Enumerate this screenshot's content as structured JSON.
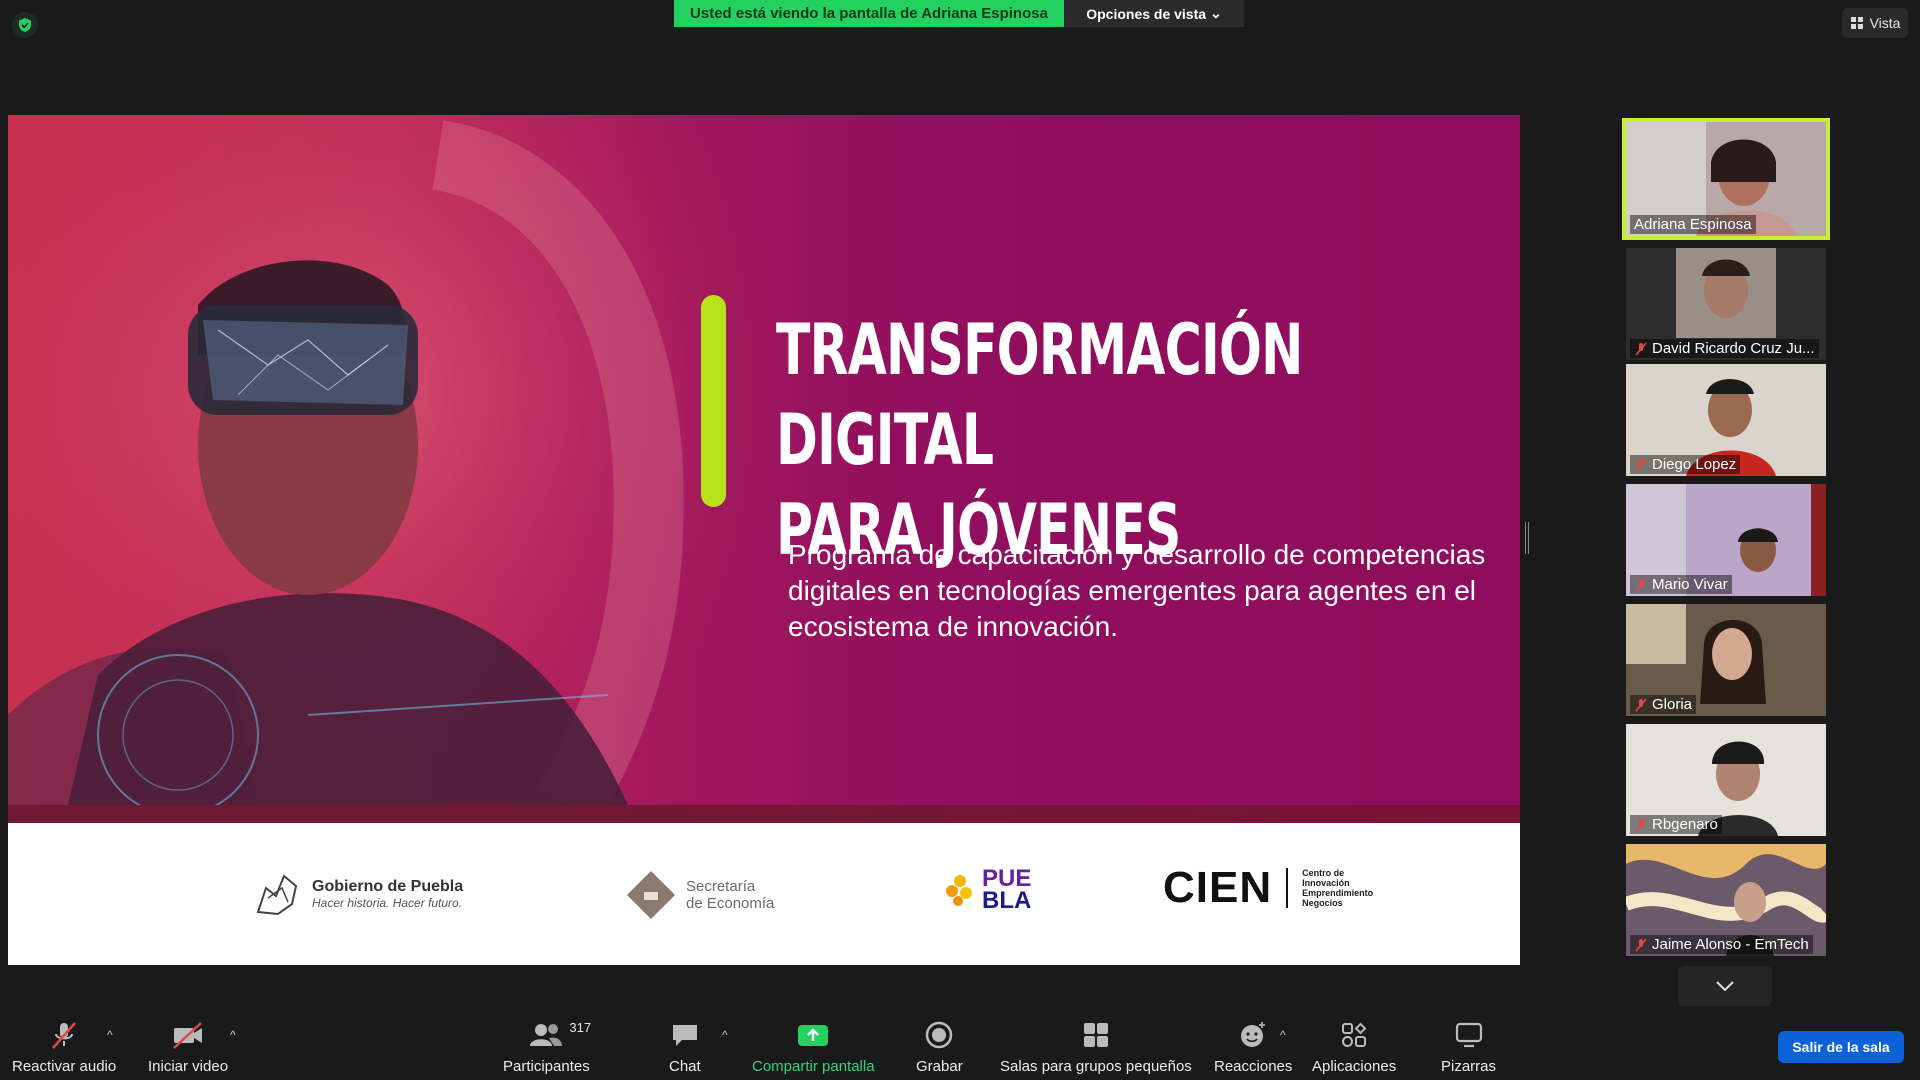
{
  "topbar": {
    "viewing_banner": "Usted está viendo la pantalla de Adriana Espinosa",
    "view_options": "Opciones de vista",
    "vista": "Vista"
  },
  "slide": {
    "title_line1": "TRANSFORMACIÓN DIGITAL",
    "title_line2": "PARA JÓVENES",
    "subtitle": "Programa de capacitación y desarrollo de competencias digitales en tecnologías emergentes para agentes en el ecosistema de innovación.",
    "logos": {
      "gobierno_name": "Gobierno de Puebla",
      "gobierno_tag": "Hacer historia. Hacer futuro.",
      "secretaria_line1": "Secretaría",
      "secretaria_line2": "de Economía",
      "puebla_line1": "PUE",
      "puebla_line2": "BLA",
      "cien": "CIEN",
      "cien_sub1": "Centro de",
      "cien_sub2": "Innovación",
      "cien_sub3": "Emprendimiento",
      "cien_sub4": "Negocios"
    }
  },
  "gallery": {
    "participants": [
      {
        "name": "Adriana Espinosa",
        "muted": false,
        "active": true
      },
      {
        "name": "David Ricardo Cruz Ju...",
        "muted": true,
        "active": false
      },
      {
        "name": "Diego Lopez",
        "muted": true,
        "active": false
      },
      {
        "name": "Mario Vivar",
        "muted": true,
        "active": false
      },
      {
        "name": "Gloria",
        "muted": true,
        "active": false
      },
      {
        "name": "Rbgenaro",
        "muted": true,
        "active": false
      },
      {
        "name": "Jaime Alonso - EmTech",
        "muted": true,
        "active": false
      }
    ]
  },
  "toolbar": {
    "unmute": "Reactivar audio",
    "start_video": "Iniciar video",
    "participants": "Participantes",
    "participants_count": "317",
    "chat": "Chat",
    "share_screen": "Compartir pantalla",
    "record": "Grabar",
    "breakout": "Salas para grupos pequeños",
    "reactions": "Reacciones",
    "apps": "Aplicaciones",
    "whiteboards": "Pizarras",
    "leave": "Salir de la sala"
  },
  "colors": {
    "banner_green": "#23d160",
    "slide_magenta": "#8e0d5c",
    "accent_lime": "#b8e21a",
    "leave_blue": "#0e62d9",
    "active_speaker_border": "#c6ef36"
  }
}
